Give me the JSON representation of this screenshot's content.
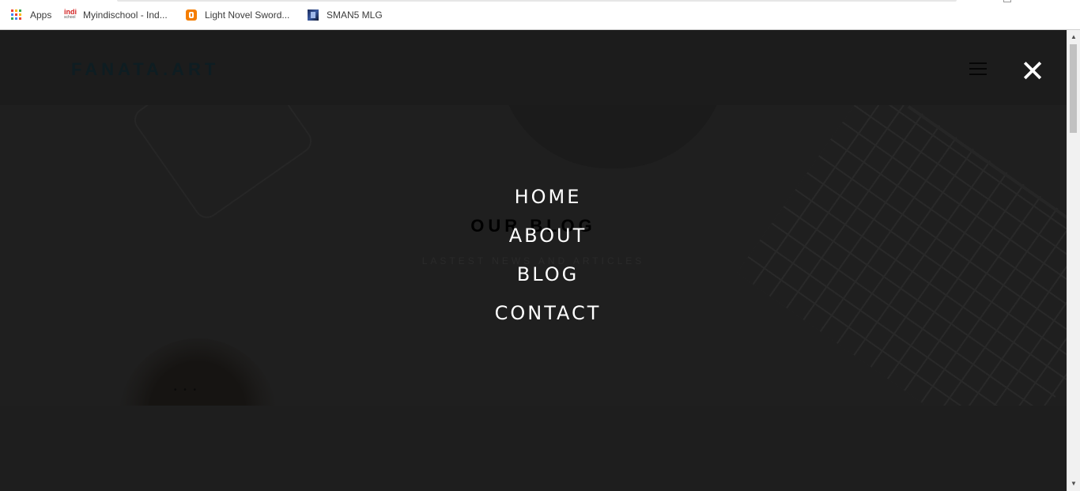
{
  "bookmarks": [
    {
      "label": "Apps",
      "icon": "apps-grid-icon"
    },
    {
      "label": "Myindischool - Ind...",
      "icon": "indischool-favicon"
    },
    {
      "label": "Light Novel Sword...",
      "icon": "blogger-favicon"
    },
    {
      "label": "SMAN5 MLG",
      "icon": "sman5-favicon"
    }
  ],
  "site": {
    "logo": "FANATA.ART",
    "close_icon": "✕"
  },
  "hero": {
    "title": "OUR BLOG",
    "subtitle": "LASTEST NEWS AND ARTICLES"
  },
  "menu": {
    "items": [
      "HOME",
      "ABOUT",
      "BLOG",
      "CONTACT"
    ]
  },
  "favicon_text": {
    "indi": "indi",
    "indi_small": "school"
  },
  "scrollbar": {
    "up_arrow": "▲",
    "down_arrow": "▼"
  },
  "colors": {
    "overlay_bg": "#1e1e1e",
    "menu_text": "#ffffff",
    "blogger": "#f57d00",
    "apps_colors": [
      "#ea4335",
      "#fbbc05",
      "#34a853",
      "#4285f4",
      "#ea4335",
      "#fbbc05",
      "#34a853",
      "#4285f4",
      "#ea4335"
    ]
  }
}
